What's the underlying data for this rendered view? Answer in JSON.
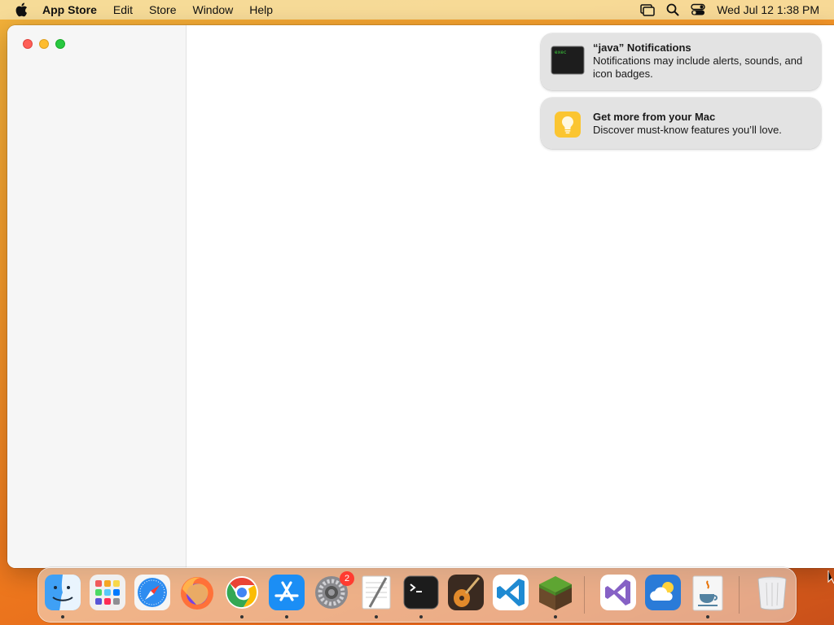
{
  "menubar": {
    "app_name": "App Store",
    "menus": [
      "Edit",
      "Store",
      "Window",
      "Help"
    ],
    "clock": "Wed Jul 12  1:38 PM"
  },
  "notifications": [
    {
      "icon": "exec-terminal-icon",
      "title": "“java” Notifications",
      "body": "Notifications may include alerts, sounds, and icon badges."
    },
    {
      "icon": "lightbulb-icon",
      "title": "Get more from your Mac",
      "body": "Discover must-know features you’ll love."
    }
  ],
  "dock": {
    "apps": [
      {
        "name": "Finder",
        "running": true
      },
      {
        "name": "Launchpad",
        "running": false
      },
      {
        "name": "Safari",
        "running": false
      },
      {
        "name": "Firefox",
        "running": false
      },
      {
        "name": "Chrome",
        "running": true
      },
      {
        "name": "App Store",
        "running": true
      },
      {
        "name": "System Settings",
        "running": false,
        "badge": "2"
      },
      {
        "name": "TextEdit",
        "running": true
      },
      {
        "name": "Terminal",
        "running": true
      },
      {
        "name": "GarageBand",
        "running": false
      },
      {
        "name": "VS Code",
        "running": false
      },
      {
        "name": "Minecraft",
        "running": true
      },
      {
        "name": "Visual Studio",
        "running": false
      },
      {
        "name": "Weather",
        "running": false
      },
      {
        "name": "Java",
        "running": true
      },
      {
        "name": "Trash",
        "running": false
      }
    ]
  },
  "colors": {
    "close": "#fe5f57",
    "minimize": "#febc2e",
    "maximize": "#28c840",
    "badge": "#ff3b30"
  }
}
